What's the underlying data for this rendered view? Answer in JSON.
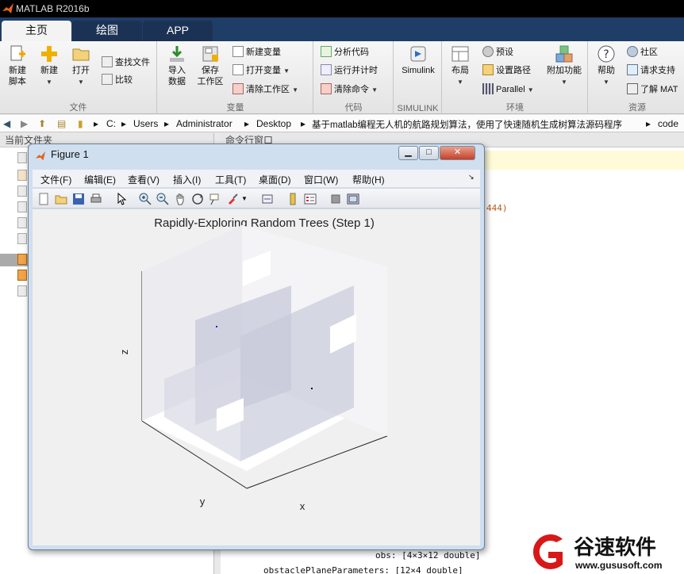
{
  "app": {
    "title": "MATLAB R2016b"
  },
  "tabs": [
    {
      "label": "主页",
      "active": true
    },
    {
      "label": "绘图",
      "active": false
    },
    {
      "label": "APP",
      "active": false
    }
  ],
  "ribbon": {
    "file_group": {
      "title": "文件",
      "new_script": "新建\n脚本",
      "new": "新建",
      "open": "打开",
      "find_files": "查找文件",
      "compare": "比较"
    },
    "variable_group": {
      "title": "变量",
      "import_data": "导入\n数据",
      "save_workspace": "保存\n工作区",
      "new_variable": "新建变量",
      "open_variable": "打开变量",
      "clear_workspace": "清除工作区"
    },
    "code_group": {
      "title": "代码",
      "analyze_code": "分析代码",
      "run_and_time": "运行并计时",
      "clear_commands": "清除命令"
    },
    "simulink_group": {
      "title": "SIMULINK",
      "simulink": "Simulink"
    },
    "env_group": {
      "title": "环境",
      "layout": "布局",
      "preferences": "预设",
      "set_path": "设置路径",
      "parallel": "Parallel",
      "addons": "附加功能"
    },
    "resources_group": {
      "title": "资源",
      "help": "帮助",
      "community": "社区",
      "request_support": "请求支持",
      "learn_matlab": "了解 MAT"
    }
  },
  "address": {
    "parts": [
      "C:",
      "Users",
      "Administrator",
      "Desktop",
      "基于matlab编程无人机的航路规划算法，使用了快速随机生成树算法源码程序",
      "code"
    ]
  },
  "left_panel": {
    "header": "当前文件夹"
  },
  "command_window": {
    "header": "命令行窗口",
    "partial": "444)",
    "lines": [
      "obs: [4×3×12 double]",
      "obstaclePlaneParameters: [12×4 double]"
    ]
  },
  "figure": {
    "title": "Figure 1",
    "menu": [
      "文件(F)",
      "编辑(E)",
      "查看(V)",
      "插入(I)",
      "工具(T)",
      "桌面(D)",
      "窗口(W)",
      "帮助(H)"
    ],
    "plot": {
      "title": "Rapidly-Exploring Random Trees (Step 1)",
      "xlabel": "x",
      "ylabel": "y",
      "zlabel": "z"
    }
  },
  "watermark": {
    "text": "谷速软件",
    "url": "www.gususoft.com"
  },
  "colors": {
    "tab_bg": "#1e3e68",
    "ribbon": "#ececec",
    "plot_plane": "#c8cadb"
  }
}
